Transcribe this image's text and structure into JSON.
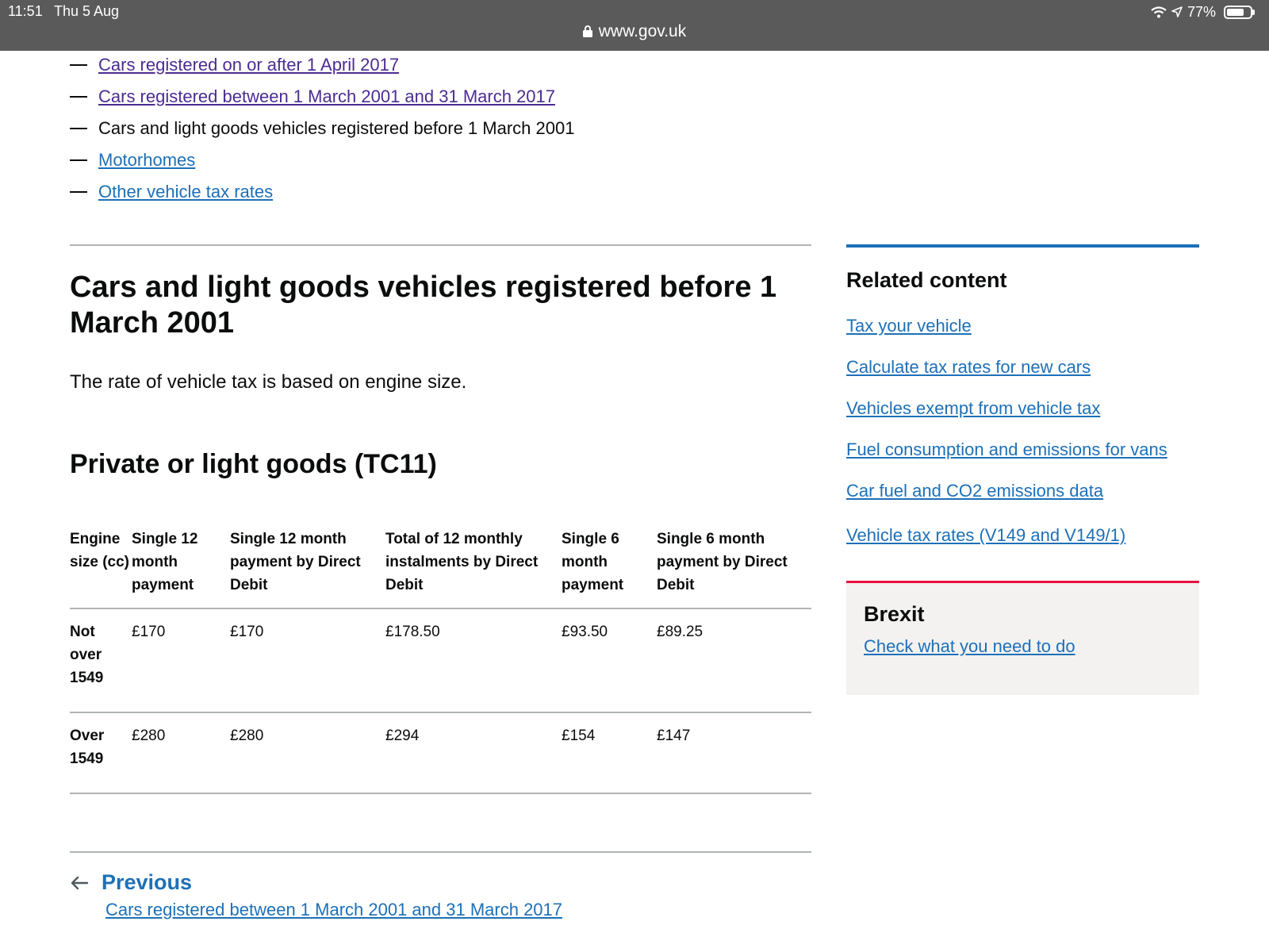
{
  "status_bar": {
    "time": "11:51",
    "date": "Thu 5 Aug",
    "url": "www.gov.uk",
    "battery": "77%",
    "battery_level": 0.77
  },
  "contents": [
    {
      "label": "Cars registered on or after 1 April 2017",
      "state": "visited"
    },
    {
      "label": "Cars registered between 1 March 2001 and 31 March 2017",
      "state": "visited"
    },
    {
      "label": "Cars and light goods vehicles registered before 1 March 2001",
      "state": "current"
    },
    {
      "label": "Motorhomes",
      "state": "link"
    },
    {
      "label": "Other vehicle tax rates",
      "state": "link"
    }
  ],
  "main": {
    "title": "Cars and light goods vehicles registered before 1 March 2001",
    "lead": "The rate of vehicle tax is based on engine size.",
    "subheading": "Private or light goods (TC11)",
    "table": {
      "headers": [
        "Engine size (cc)",
        "Single 12 month payment",
        "Single 12 month payment by Direct Debit",
        "Total of 12 monthly instalments by Direct Debit",
        "Single 6 month payment",
        "Single 6 month payment by Direct Debit"
      ],
      "rows": [
        [
          "Not over 1549",
          "£170",
          "£170",
          "£178.50",
          "£93.50",
          "£89.25"
        ],
        [
          "Over 1549",
          "£280",
          "£280",
          "£294",
          "£154",
          "£147"
        ]
      ]
    },
    "previous": {
      "label": "Previous",
      "link": "Cars registered between 1 March 2001 and 31 March 2017"
    }
  },
  "sidebar": {
    "title": "Related content",
    "links": [
      "Tax your vehicle",
      "Calculate tax rates for new cars",
      "Vehicles exempt from vehicle tax",
      "Fuel consumption and emissions for vans",
      "Car fuel and CO2 emissions data",
      "Vehicle tax rates (V149 and V149/1)"
    ]
  },
  "brexit": {
    "title": "Brexit",
    "link": "Check what you need to do"
  },
  "colors": {
    "link": "#1d70b8",
    "visited": "#4c2c92",
    "text": "#0b0c0c",
    "rule": "#b1b4b6",
    "brexit_accent": "#e8103e",
    "status_bar": "#5a5a5a"
  }
}
